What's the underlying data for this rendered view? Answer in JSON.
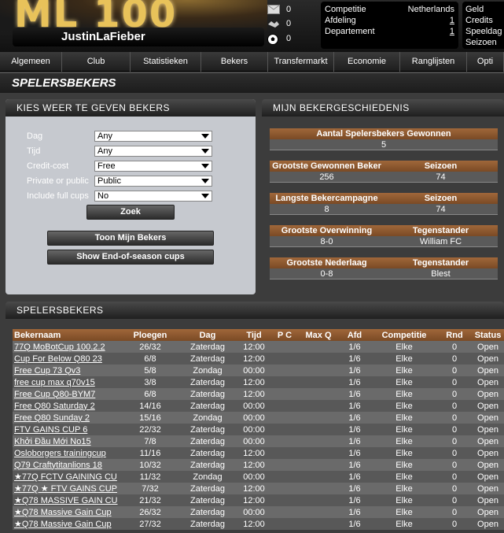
{
  "header": {
    "logo_text": "ML 100",
    "username": "JustinLaFieber",
    "stats": [
      {
        "icon": "mail-icon",
        "value": "0"
      },
      {
        "icon": "handshake-icon",
        "value": "0"
      },
      {
        "icon": "soccer-ball-icon",
        "value": "0"
      }
    ],
    "info": {
      "competitie_label": "Competitie",
      "competitie_value": "Netherlands",
      "afdeling_label": "Afdeling",
      "afdeling_value": "1",
      "departement_label": "Departement",
      "departement_value": "1"
    },
    "info2": [
      "Geld",
      "Credits",
      "Speeldag",
      "Seizoen"
    ]
  },
  "nav": [
    "Algemeen",
    "Club",
    "Statistieken",
    "Bekers",
    "Transfermarkt",
    "Economie",
    "Ranglijsten",
    "Opti"
  ],
  "page_title": "SPELERSBEKERS",
  "kies": {
    "title": "KIES WEER TE GEVEN BEKERS",
    "fields": [
      {
        "label": "Dag",
        "value": "Any"
      },
      {
        "label": "Tijd",
        "value": "Any"
      },
      {
        "label": "Credit-cost",
        "value": "Free"
      },
      {
        "label": "Private or public",
        "value": "Public"
      },
      {
        "label": "Include full cups",
        "value": "No"
      }
    ],
    "zoek": "Zoek",
    "toon": "Toon Mijn Bekers",
    "show_eos": "Show End-of-season cups"
  },
  "mijn": {
    "title": "MIJN BEKERGESCHIEDENIS",
    "aantal_label": "Aantal Spelersbekers Gewonnen",
    "aantal_value": "5",
    "grootste_label": "Grootste Gewonnen Beker",
    "seizoen_label": "Seizoen",
    "grootste_value": "256",
    "grootste_seizoen": "74",
    "langste_label": "Langste Bekercampagne",
    "langste_value": "8",
    "langste_seizoen": "74",
    "overwinning_label": "Grootste Overwinning",
    "tegenstander_label": "Tegenstander",
    "overwinning_value": "8-0",
    "overwinning_tegen": "William FC",
    "nederlaag_label": "Grootste Nederlaag",
    "nederlaag_value": "0-8",
    "nederlaag_tegen": "Blest"
  },
  "spelers": {
    "title": "SPELERSBEKERS",
    "columns": [
      "Bekernaam",
      "Ploegen",
      "Dag",
      "Tijd",
      "P C",
      "Max Q",
      "Afd",
      "Competitie",
      "Rnd",
      "Status"
    ],
    "rows": [
      [
        "77Q MoBotCup 100.2.2",
        "26/32",
        "Zaterdag",
        "12:00",
        "",
        "",
        "1/6",
        "Elke",
        "0",
        "Open"
      ],
      [
        "Cup For Below Q80 23",
        "6/8",
        "Zaterdag",
        "12:00",
        "",
        "",
        "1/6",
        "Elke",
        "0",
        "Open"
      ],
      [
        "Free Cup 73 Qv3",
        "5/8",
        "Zondag",
        "00:00",
        "",
        "",
        "1/6",
        "Elke",
        "0",
        "Open"
      ],
      [
        "free cup max q70v15",
        "3/8",
        "Zaterdag",
        "12:00",
        "",
        "",
        "1/6",
        "Elke",
        "0",
        "Open"
      ],
      [
        "Free Cup Q80-BYM7",
        "6/8",
        "Zaterdag",
        "12:00",
        "",
        "",
        "1/6",
        "Elke",
        "0",
        "Open"
      ],
      [
        "Free Q80 Saturday 2",
        "14/16",
        "Zaterdag",
        "00:00",
        "",
        "",
        "1/6",
        "Elke",
        "0",
        "Open"
      ],
      [
        "Free Q80 Sunday 2",
        "15/16",
        "Zondag",
        "00:00",
        "",
        "",
        "1/6",
        "Elke",
        "0",
        "Open"
      ],
      [
        "FTV GAINS CUP 6",
        "22/32",
        "Zaterdag",
        "00:00",
        "",
        "",
        "1/6",
        "Elke",
        "0",
        "Open"
      ],
      [
        "Khởi Đầu Mới No15",
        "7/8",
        "Zaterdag",
        "00:00",
        "",
        "",
        "1/6",
        "Elke",
        "0",
        "Open"
      ],
      [
        "Osloborgers trainingcup",
        "11/16",
        "Zaterdag",
        "12:00",
        "",
        "",
        "1/6",
        "Elke",
        "0",
        "Open"
      ],
      [
        "Q79 Craftytitanlions 18",
        "10/32",
        "Zaterdag",
        "12:00",
        "",
        "",
        "1/6",
        "Elke",
        "0",
        "Open"
      ],
      [
        "★77Q FCTV GAINING CU",
        "11/32",
        "Zondag",
        "00:00",
        "",
        "",
        "1/6",
        "Elke",
        "0",
        "Open"
      ],
      [
        "★77Q ★ FTV GAINS CUP",
        "7/32",
        "Zaterdag",
        "12:00",
        "",
        "",
        "1/6",
        "Elke",
        "0",
        "Open"
      ],
      [
        "★Q78 MASSIVE GAIN CU",
        "21/32",
        "Zaterdag",
        "12:00",
        "",
        "",
        "1/6",
        "Elke",
        "0",
        "Open"
      ],
      [
        "★Q78 Massive Gain Cup",
        "26/32",
        "Zaterdag",
        "00:00",
        "",
        "",
        "1/6",
        "Elke",
        "0",
        "Open"
      ],
      [
        "★Q78 Massive Gain Cup",
        "27/32",
        "Zaterdag",
        "12:00",
        "",
        "",
        "1/6",
        "Elke",
        "0",
        "Open"
      ]
    ]
  }
}
